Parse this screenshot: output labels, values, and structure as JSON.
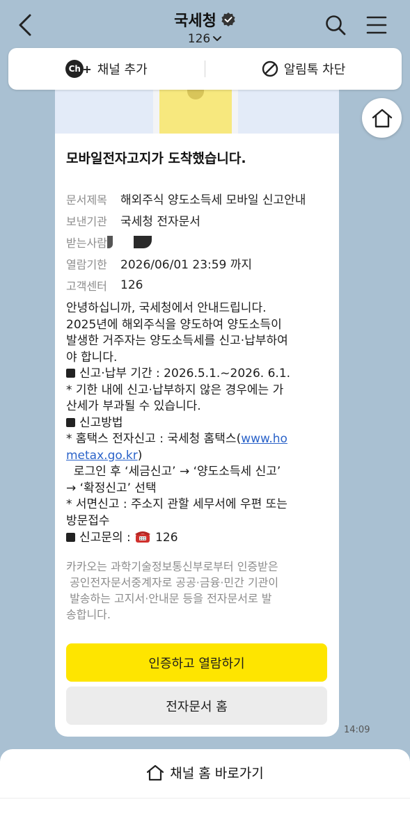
{
  "header": {
    "title": "국세청",
    "subscriber_count": "126"
  },
  "channel_bar": {
    "add_channel_label": "채널 추가",
    "block_label": "알림톡 차단",
    "ch_badge": "Ch"
  },
  "message": {
    "title": "모바일전자고지가 도착했습니다.",
    "info": [
      {
        "label": "문서제목",
        "value": "해외주식 양도소득세 모바일 신고안내"
      },
      {
        "label": "보낸기관",
        "value": "국세청 전자문서"
      },
      {
        "label": "받는사람",
        "value": ""
      },
      {
        "label": "열람기한",
        "value": "2026/06/01 23:59 까지"
      },
      {
        "label": "고객센터",
        "value": "126"
      }
    ],
    "body": {
      "l1": "안녕하십니까, 국세청에서 안내드립니다.",
      "l2": "2025년에 해외주식을 양도하여 양도소득이",
      "l3": "발생한 거주자는 양도소득세를 신고·납부하여",
      "l4": "야 합니다.",
      "l5": "신고·납부 기간 : 2026.5.1.~2026. 6.1.",
      "l6": "* 기한 내에 신고·납부하지 않은 경우에는 가",
      "l7": "산세가 부과될 수 있습니다.",
      "l8": "신고방법",
      "l9_prefix": "* 홈택스 전자신고 : 국세청 홈택스(",
      "l9_link": "www.ho",
      "l10_link": "metax.go.kr",
      "l10_suffix": ")",
      "l11": "  로그인 후 ‘세금신고’ → ‘양도소득세 신고’",
      "l12": "→ ‘확정신고’ 선택",
      "l13": "* 서면신고 : 주소지 관할 세무서에 우편 또는",
      "l14": "방문접수",
      "l15_prefix": "신고문의 : ",
      "l15_value": "126"
    },
    "footer_note": {
      "l1": "카카오는 과학기술정보통신부로부터 인증받은",
      "l2": " 공인전자문서중계자로 공공·금융·민간 기관이",
      "l3": " 발송하는 고지서·안내문 등을 전자문서로 발",
      "l4": "송합니다."
    },
    "primary_button": "인증하고 열람하기",
    "secondary_button": "전자문서 홈",
    "timestamp": "14:09"
  },
  "bottom_sheet": {
    "channel_home_label": "채널 홈 바로가기"
  },
  "colors": {
    "background": "#a9c0d2",
    "primary_button": "#fee500",
    "secondary_button": "#ececec",
    "link": "#2b63c9"
  },
  "icons": [
    "back-arrow-icon",
    "verified-badge-icon",
    "chevron-down-icon",
    "search-icon",
    "menu-icon",
    "channel-add-icon",
    "block-icon",
    "home-icon",
    "phone-icon"
  ]
}
